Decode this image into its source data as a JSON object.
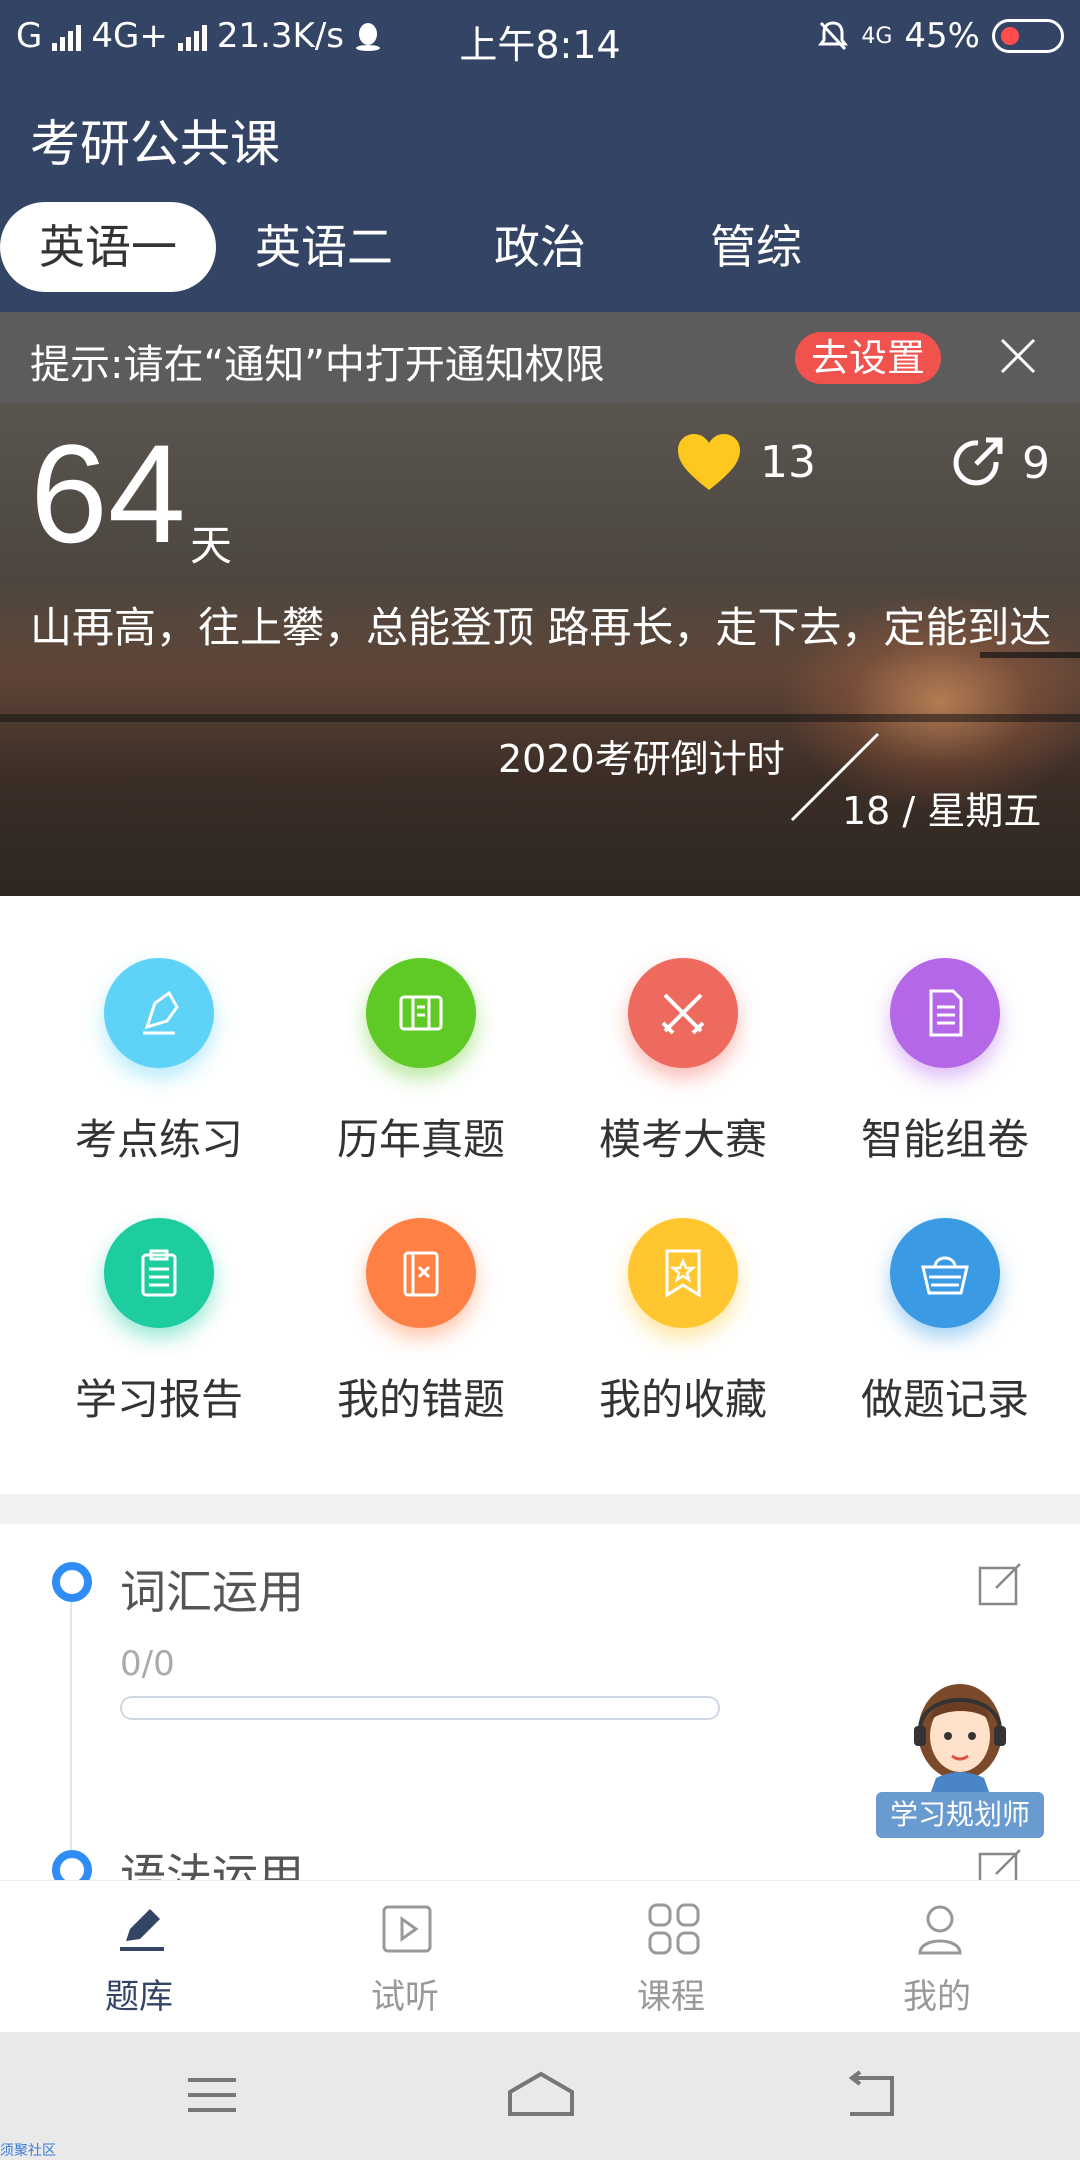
{
  "status_bar": {
    "carrier": "G",
    "network": "4G+",
    "speed": "21.3K/s",
    "time": "上午8:14",
    "battery": "45%",
    "volte": "4G"
  },
  "header": {
    "title": "考研公共课",
    "tabs": [
      {
        "label": "英语一",
        "active": true
      },
      {
        "label": "英语二",
        "active": false
      },
      {
        "label": "政治",
        "active": false
      },
      {
        "label": "管综",
        "active": false
      }
    ]
  },
  "notice": {
    "text": "提示:请在“通知”中打开通知权限",
    "button": "去设置"
  },
  "hero": {
    "days": "64",
    "days_unit": "天",
    "likes": "13",
    "shares": "9",
    "motto": "山再高，往上攀，总能登顶 路再长，走下去，定能到达",
    "countdown_label": "2020考研倒计时",
    "date": "18 / 星期五"
  },
  "features": [
    {
      "label": "考点练习",
      "icon": "pen-icon",
      "color": "#5fd3f7"
    },
    {
      "label": "历年真题",
      "icon": "book-icon",
      "color": "#5fc926"
    },
    {
      "label": "模考大赛",
      "icon": "swords-icon",
      "color": "#ef6a5e"
    },
    {
      "label": "智能组卷",
      "icon": "document-icon",
      "color": "#b468e8"
    },
    {
      "label": "学习报告",
      "icon": "clipboard-icon",
      "color": "#1dcc9f"
    },
    {
      "label": "我的错题",
      "icon": "error-book-icon",
      "color": "#ff8045"
    },
    {
      "label": "我的收藏",
      "icon": "star-bookmark-icon",
      "color": "#ffc62f"
    },
    {
      "label": "做题记录",
      "icon": "basket-icon",
      "color": "#3a9be4"
    }
  ],
  "practice": {
    "sections": [
      {
        "title": "词汇运用",
        "progress": "0/0",
        "fraction": 0
      },
      {
        "title": "语法运用"
      }
    ]
  },
  "assistant": {
    "label": "学习规划师"
  },
  "bottom_nav": [
    {
      "label": "题库",
      "icon": "pencil-icon",
      "active": true
    },
    {
      "label": "试听",
      "icon": "play-icon",
      "active": false
    },
    {
      "label": "课程",
      "icon": "grid-icon",
      "active": false
    },
    {
      "label": "我的",
      "icon": "user-icon",
      "active": false
    }
  ],
  "watermark": "须聚社区"
}
